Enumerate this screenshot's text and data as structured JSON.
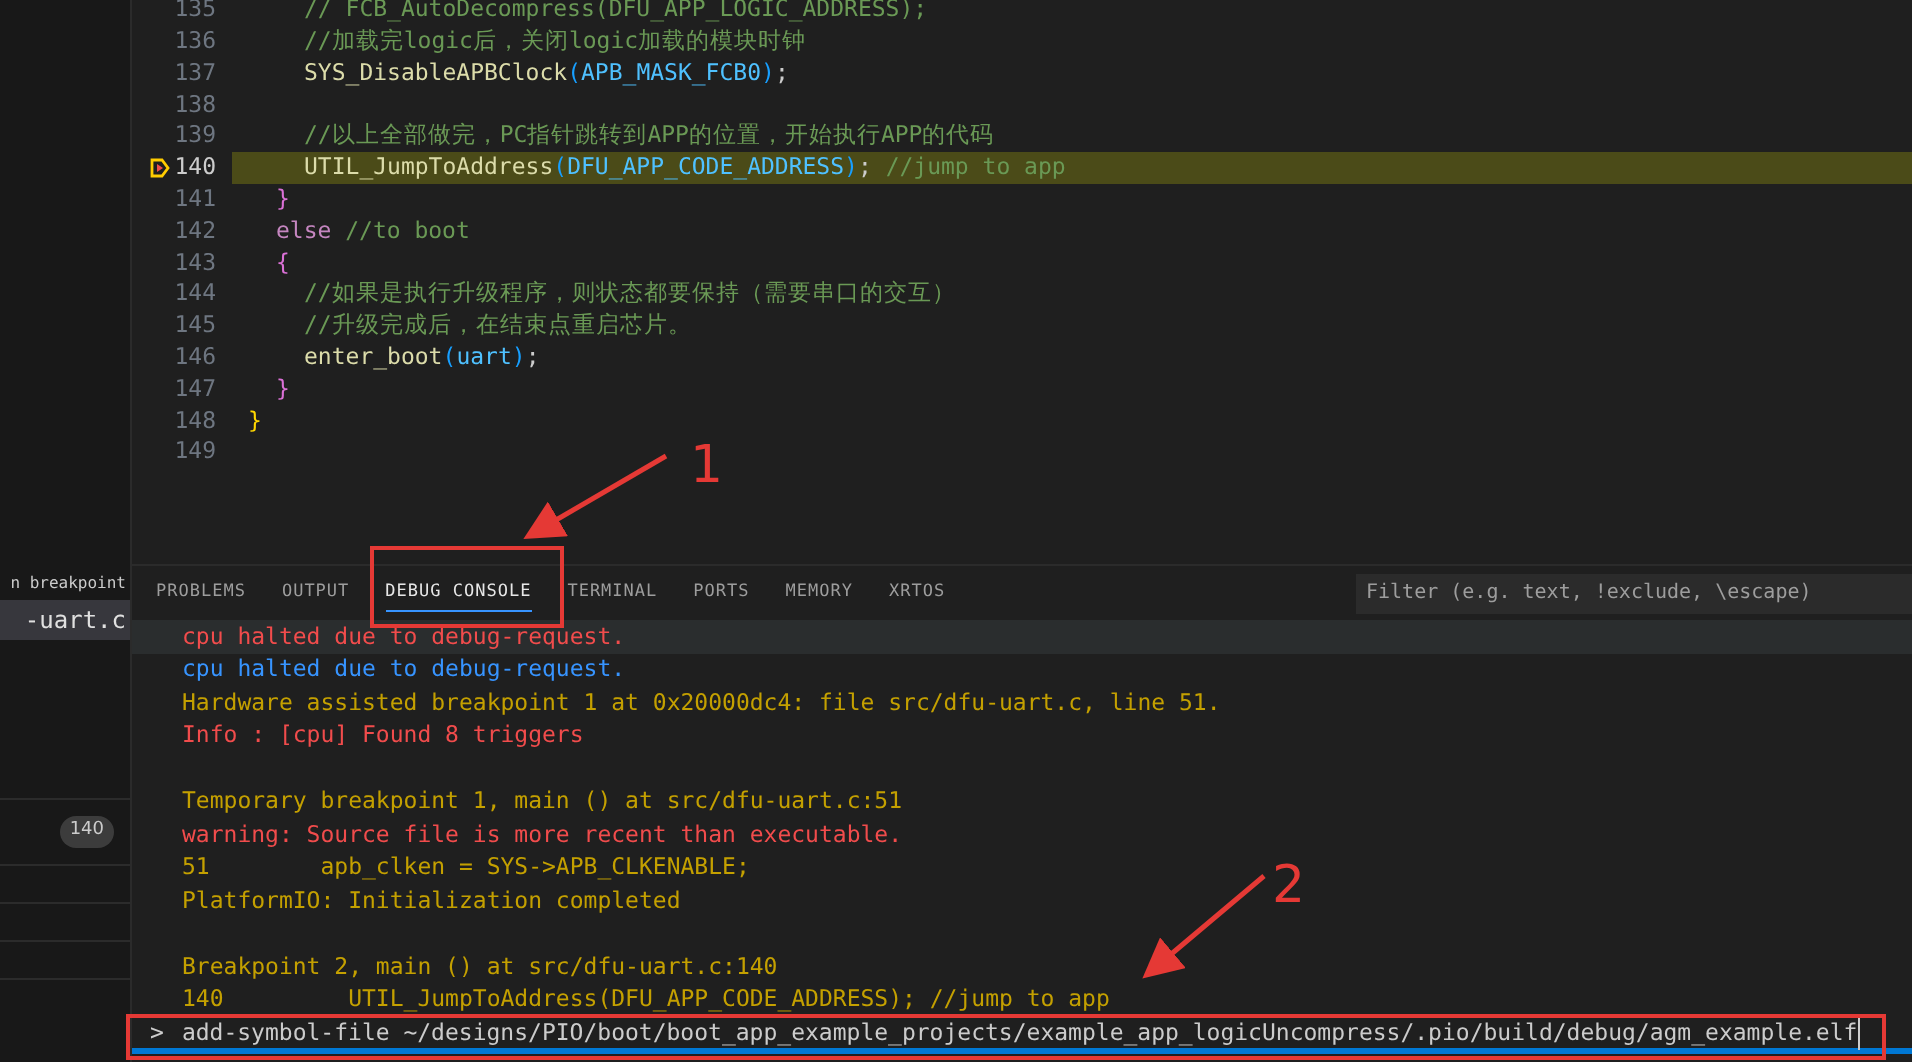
{
  "sidebar": {
    "items": [
      {
        "label": "n breakpoint",
        "selected": false
      },
      {
        "label": "-uart.c",
        "selected": true
      }
    ],
    "badge": "140"
  },
  "editor": {
    "lines": [
      {
        "number": "135",
        "current": false,
        "kind": "deep",
        "segments": [
          {
            "kind": "comment",
            "text": "// FCB_AutoDecompress(DFU_APP_LOGIC_ADDRESS);"
          }
        ]
      },
      {
        "number": "136",
        "current": false,
        "kind": "deep",
        "segments": [
          {
            "kind": "comment",
            "text": "//加载完logic后，关闭logic加载的模块时钟"
          }
        ]
      },
      {
        "number": "137",
        "current": false,
        "kind": "deep",
        "segments": [
          {
            "kind": "func",
            "text": "SYS_DisableAPBClock"
          },
          {
            "kind": "paren",
            "text": "("
          },
          {
            "kind": "const",
            "text": "APB_MASK_FCB0"
          },
          {
            "kind": "paren",
            "text": ")"
          },
          {
            "kind": "text",
            "text": ";"
          }
        ]
      },
      {
        "number": "138",
        "current": false,
        "kind": "empty"
      },
      {
        "number": "139",
        "current": false,
        "kind": "deep",
        "segments": [
          {
            "kind": "comment",
            "text": "//以上全部做完，PC指针跳转到APP的位置，开始执行APP的代码"
          }
        ]
      },
      {
        "number": "140",
        "current": true,
        "kind": "deep",
        "segments": [
          {
            "kind": "func",
            "text": "UTIL_JumpToAddress"
          },
          {
            "kind": "paren",
            "text": "("
          },
          {
            "kind": "const",
            "text": "DFU_APP_CODE_ADDRESS"
          },
          {
            "kind": "paren",
            "text": ")"
          },
          {
            "kind": "text",
            "text": ";"
          },
          {
            "kind": "comment",
            "text": "//jump to app"
          }
        ]
      },
      {
        "number": "141",
        "current": false,
        "kind": "nested",
        "segments": [
          {
            "kind": "brace",
            "text": "}"
          }
        ]
      },
      {
        "number": "142",
        "current": false,
        "kind": "nested",
        "segments": [
          {
            "kind": "keyword",
            "text": "else"
          },
          {
            "kind": "comment",
            "text": "//to boot"
          }
        ]
      },
      {
        "number": "143",
        "current": false,
        "kind": "nested",
        "segments": [
          {
            "kind": "brace",
            "text": "{"
          }
        ]
      },
      {
        "number": "144",
        "current": false,
        "kind": "deep",
        "segments": [
          {
            "kind": "comment",
            "text": "//如果是执行升级程序，则状态都要保持（需要串口的交互）"
          }
        ]
      },
      {
        "number": "145",
        "current": false,
        "kind": "deep",
        "segments": [
          {
            "kind": "comment",
            "text": "//升级完成后，在结束点重启芯片。"
          }
        ]
      },
      {
        "number": "146",
        "current": false,
        "kind": "deep",
        "segments": [
          {
            "kind": "func",
            "text": "enter_boot"
          },
          {
            "kind": "paren",
            "text": "("
          },
          {
            "kind": "const",
            "text": "uart"
          },
          {
            "kind": "paren",
            "text": ")"
          },
          {
            "kind": "text",
            "text": ";"
          }
        ]
      },
      {
        "number": "147",
        "current": false,
        "kind": "nested",
        "segments": [
          {
            "kind": "brace",
            "text": "}"
          }
        ]
      },
      {
        "number": "148",
        "current": false,
        "kind": "top",
        "segments": [
          {
            "kind": "outer",
            "text": "}"
          }
        ]
      },
      {
        "number": "149",
        "current": false,
        "kind": "empty"
      }
    ]
  },
  "panel": {
    "tabs": [
      {
        "label": "PROBLEMS",
        "selected": false
      },
      {
        "label": "OUTPUT",
        "selected": false
      },
      {
        "label": "DEBUG CONSOLE",
        "selected": true
      },
      {
        "label": "TERMINAL",
        "selected": false
      },
      {
        "label": "PORTS",
        "selected": false
      },
      {
        "label": "MEMORY",
        "selected": false
      },
      {
        "label": "XRTOS",
        "selected": false
      }
    ],
    "filter": {
      "placeholder": "Filter (e.g. text, !exclude, \\escape)"
    },
    "console": [
      {
        "kind": "error",
        "text": "cpu halted due to debug-request."
      },
      {
        "kind": "info",
        "text": "cpu halted due to debug-request."
      },
      {
        "kind": "log",
        "text": "Hardware assisted breakpoint 1 at 0x20000dc4: file src/dfu-uart.c, line 51."
      },
      {
        "kind": "error",
        "text": "Info : [cpu] Found 8 triggers"
      },
      {
        "kind": "blank"
      },
      {
        "kind": "log",
        "text": "Temporary breakpoint 1, main () at src/dfu-uart.c:51"
      },
      {
        "kind": "error",
        "text": "warning: Source file is more recent than executable."
      },
      {
        "kind": "log",
        "text": "51        apb_clken = SYS->APB_CLKENABLE;"
      },
      {
        "kind": "log",
        "text": "PlatformIO: Initialization completed"
      },
      {
        "kind": "blank"
      },
      {
        "kind": "log",
        "text": "Breakpoint 2, main () at src/dfu-uart.c:140"
      },
      {
        "kind": "log",
        "text": "140         UTIL_JumpToAddress(DFU_APP_CODE_ADDRESS); //jump to app"
      }
    ],
    "prompt": ">",
    "input": "add-symbol-file ~/designs/PIO/boot/boot_app_example_projects/example_app_logicUncompress/.pio/build/debug/agm_example.elf"
  },
  "annotations": [
    "1",
    "2"
  ]
}
